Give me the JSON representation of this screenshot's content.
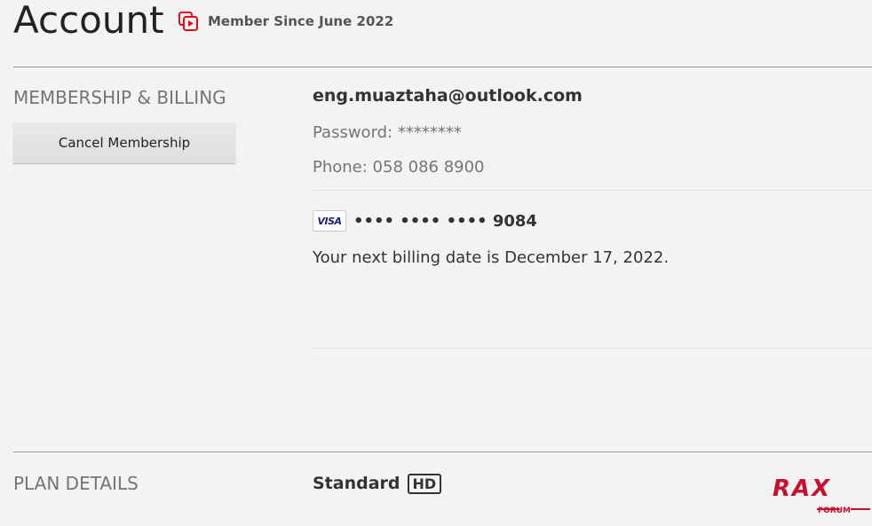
{
  "header": {
    "title": "Account",
    "member_since": "Member Since June 2022",
    "member_icon": "play-membership-icon",
    "accent_color": "#e50914"
  },
  "membership_billing": {
    "section_title": "MEMBERSHIP & BILLING",
    "cancel_button_label": "Cancel Membership",
    "email": "eng.muaztaha@outlook.com",
    "password": "Password: ********",
    "phone": "Phone: 058 086 8900",
    "card_brand": "VISA",
    "card_mask": "•••• •••• •••• 9084",
    "billing_date": "Your next billing date is December 17, 2022."
  },
  "plan_details": {
    "section_title": "PLAN DETAILS",
    "plan_name": "Standard",
    "quality_badge": "HD"
  },
  "watermark": {
    "main": "RAX",
    "sub": "FORUM",
    "color": "#c8102e"
  }
}
